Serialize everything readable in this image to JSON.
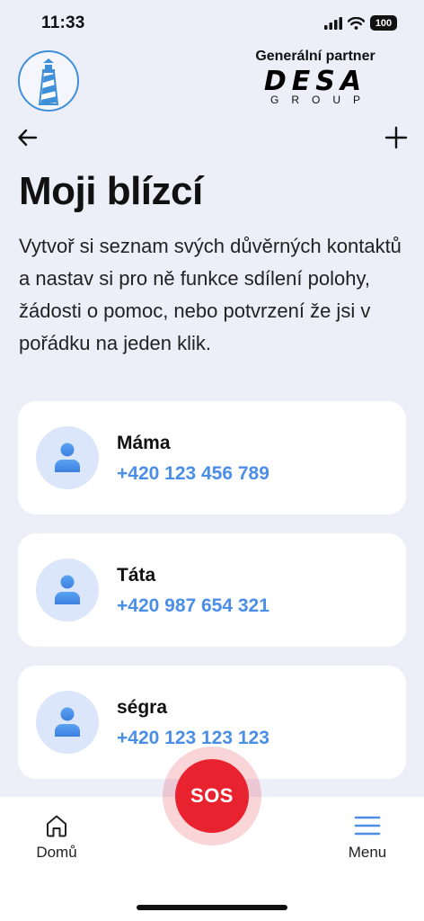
{
  "status_bar": {
    "time": "11:33",
    "battery": "100"
  },
  "header": {
    "partner_label": "Generální partner",
    "partner_brand": "DESA",
    "partner_sub": "GROUP"
  },
  "page": {
    "title": "Moji blízcí",
    "description": "Vytvoř si seznam svých důvěrných kontaktů a nastav si pro ně funkce sdílení polohy, žádosti o pomoc, nebo potvrzení že jsi v pořádku na jeden klik."
  },
  "contacts": [
    {
      "name": "Máma",
      "phone": "+420 123 456 789"
    },
    {
      "name": "Táta",
      "phone": "+420 987 654 321"
    },
    {
      "name": "ségra",
      "phone": "+420 123 123 123"
    }
  ],
  "bottom_nav": {
    "home_label": "Domů",
    "menu_label": "Menu",
    "sos_label": "SOS"
  },
  "colors": {
    "background": "#eceef8",
    "accent_blue": "#4b8ee8",
    "sos_red": "#e8232f"
  },
  "icons": [
    "signal-icon",
    "wifi-icon",
    "battery-icon",
    "lighthouse-logo",
    "back-arrow-icon",
    "plus-icon",
    "person-icon",
    "home-icon",
    "menu-icon"
  ]
}
